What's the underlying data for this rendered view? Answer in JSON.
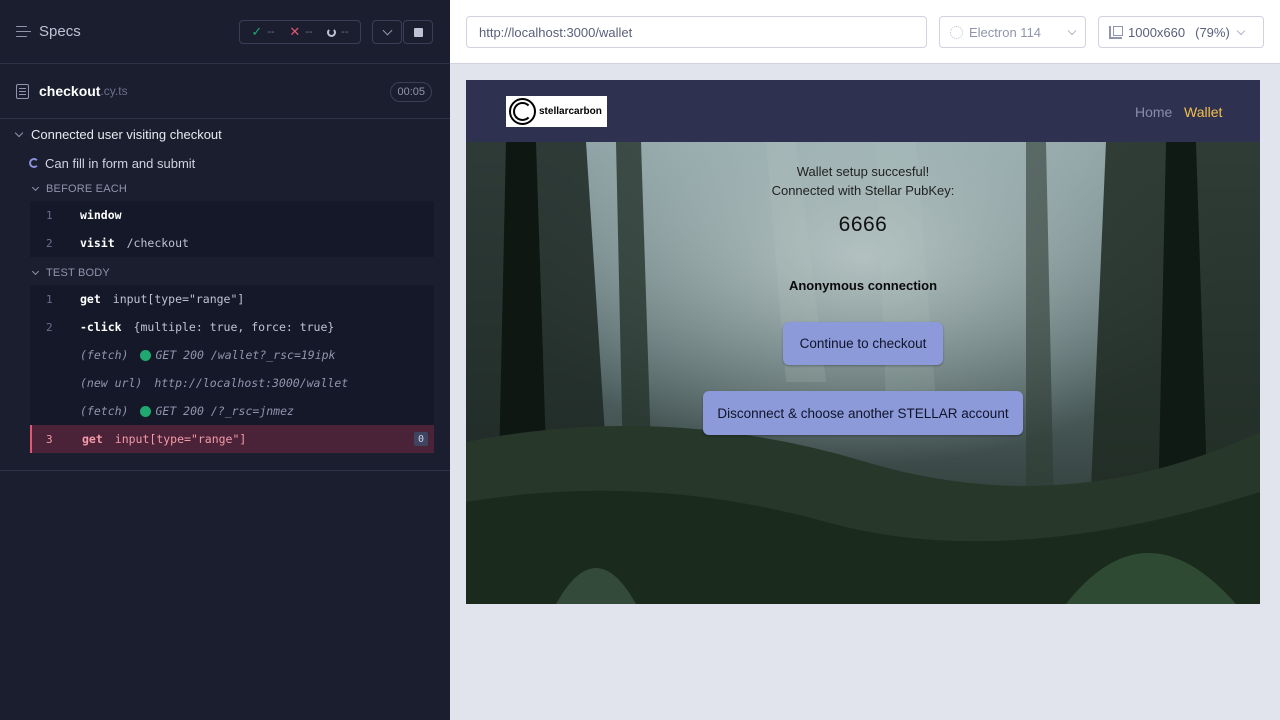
{
  "reporter": {
    "specs_label": "Specs",
    "stats": {
      "passed": "--",
      "failed": "--",
      "pending": "--"
    },
    "spec": {
      "name": "checkout",
      "ext": ".cy.ts",
      "duration": "00:05"
    },
    "suite": "Connected user visiting checkout",
    "test": "Can fill in form and submit",
    "before_each": {
      "label": "BEFORE EACH",
      "commands": [
        {
          "num": "1",
          "name": "window",
          "msg": ""
        },
        {
          "num": "2",
          "name": "visit",
          "msg": "/checkout"
        }
      ]
    },
    "test_body": {
      "label": "TEST BODY",
      "commands": [
        {
          "num": "1",
          "name": "get",
          "msg": "input[type=\"range\"]"
        },
        {
          "num": "2",
          "name": "-click",
          "msg": "{multiple: true, force: true}"
        }
      ],
      "events": [
        {
          "type": "(fetch)",
          "msg": "GET 200 /wallet?_rsc=19ipk",
          "status_color": "#1fa971"
        },
        {
          "type": "(new url)",
          "msg": "http://localhost:3000/wallet"
        },
        {
          "type": "(fetch)",
          "msg": "GET 200 /?_rsc=jnmez",
          "status_color": "#1fa971"
        }
      ],
      "failing": {
        "num": "3",
        "name": "get",
        "msg": "input[type=\"range\"]",
        "count": "0"
      }
    }
  },
  "aut": {
    "url": "http://localhost:3000/wallet",
    "browser": "Electron 114",
    "viewport": "1000x660",
    "zoom": "(79%)"
  },
  "app": {
    "logo_text": "stellarcarbon",
    "nav": {
      "home": "Home",
      "wallet": "Wallet"
    },
    "line1": "Wallet setup succesful!",
    "line2": "Connected with Stellar PubKey:",
    "pubkey": "6666",
    "anon": "Anonymous connection",
    "checkout_button": "Continue to checkout",
    "disconnect_button": "Disconnect & choose another STELLAR account"
  }
}
